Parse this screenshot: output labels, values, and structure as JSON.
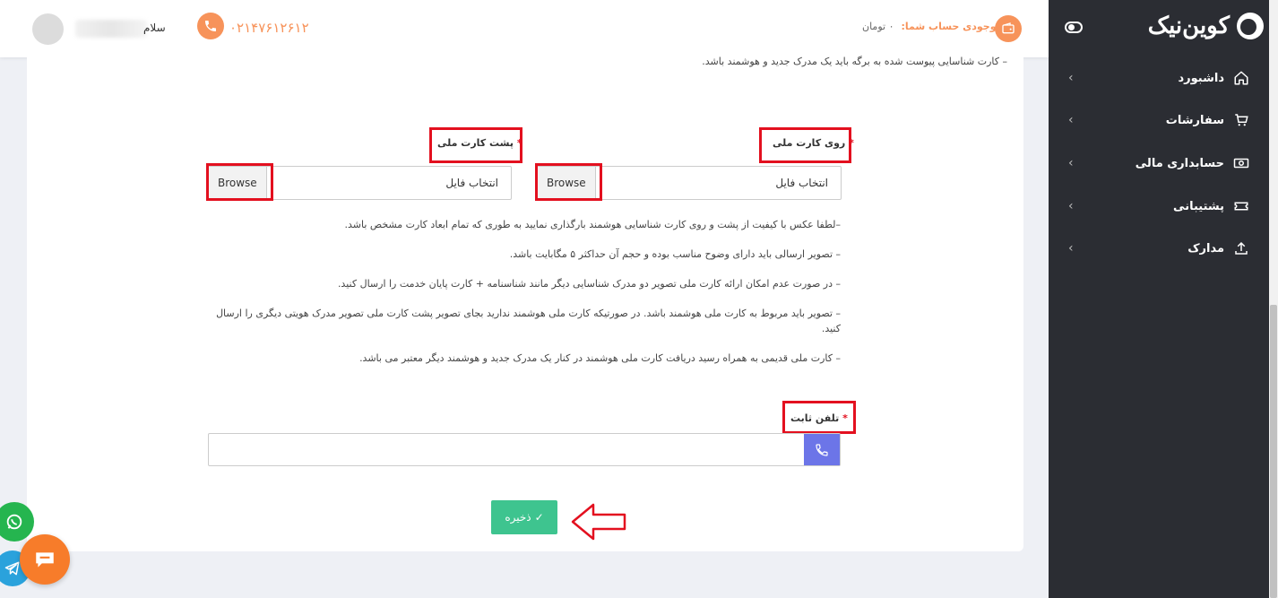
{
  "sidebar": {
    "logo_text": "کوین‌نیک",
    "items": [
      {
        "label": "داشبورد",
        "icon": "home-icon"
      },
      {
        "label": "سفارشات",
        "icon": "cart-icon"
      },
      {
        "label": "حسابداری مالی",
        "icon": "money-icon"
      },
      {
        "label": "پشتیبانی",
        "icon": "ticket-icon"
      },
      {
        "label": "مدارک",
        "icon": "upload-icon"
      }
    ]
  },
  "header": {
    "greeting": "سلام",
    "phone": "۰۲۱۴۷۶۱۲۶۱۲",
    "balance_label": "موجودی حساب شما:",
    "balance_value": "۰ تومان"
  },
  "form": {
    "top_note": "– کارت شناسایی پیوست شده به برگه باید یک مدرک جدید و هوشمند باشد.",
    "front_card_label": "روی کارت ملی",
    "back_card_label": "پشت کارت ملی",
    "required_mark": "*",
    "file_placeholder": "انتخاب فایل",
    "browse_label": "Browse",
    "notes": [
      "–لطفا عکس با کیفیت از پشت و روی کارت شناسایی هوشمند بارگذاری نمایید به طوری که تمام ابعاد کارت مشخص باشد.",
      "– تصویر ارسالی باید دارای وضوح مناسب بوده و حجم آن حداکثر ۵ مگابایت باشد.",
      "– در صورت عدم امکان ارائه کارت ملی تصویر دو مدرک شناسایی دیگر مانند شناسنامه + کارت پایان خدمت را ارسال کنید.",
      "– تصویر باید مربوط به کارت ملی هوشمند باشد. در صورتیکه کارت ملی هوشمند ندارید بجای تصویر پشت کارت ملی تصویر مدرک هویتی دیگری را ارسال کنید.",
      "– کارت ملی قدیمی به همراه رسید دریافت کارت ملی هوشمند در کنار یک مدرک جدید و هوشمند دیگر معتبر می باشد."
    ],
    "landline_label": "تلفن ثابت",
    "landline_value": "",
    "save_label": "ذخیره"
  },
  "colors": {
    "accent_orange": "#f7935a",
    "sidebar_bg": "#2b2d33",
    "save_green": "#3ec48f",
    "annotation_red": "#e3101f",
    "phone_button": "#6c75e8"
  }
}
